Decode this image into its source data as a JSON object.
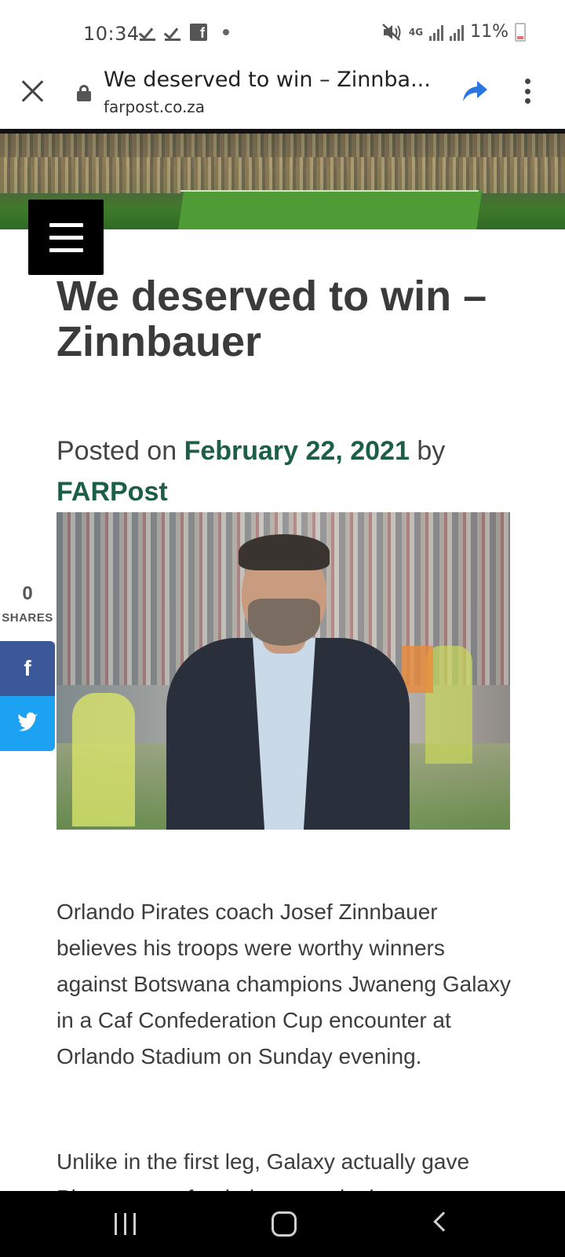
{
  "status_bar": {
    "time": "10:34",
    "network": "4G",
    "battery": "11%"
  },
  "browser": {
    "page_title": "We deserved to win – Zinnba...",
    "url": "farpost.co.za"
  },
  "article": {
    "title_line1": "We deserved to win –",
    "title_line2": "Zinnbauer",
    "posted_prefix": "Posted on",
    "date": "February 22, 2021",
    "by": "by",
    "author": "FARPost",
    "paragraph1": "Orlando Pirates coach Josef Zinnbauer believes his troops were worthy winners against Botswana champions Jwaneng Galaxy in a Caf Confederation Cup encounter at Orlando Stadium on Sunday evening.",
    "paragraph2": "Unlike in the first leg, Galaxy actually gave Pirates a run for their money in the return"
  },
  "share_sidebar": {
    "count": "0",
    "label": "SHARES"
  },
  "icons": {
    "facebook": "facebook-icon",
    "twitter": "twitter-icon",
    "menu": "hamburger-icon",
    "share": "share-arrow-icon"
  },
  "colors": {
    "link_green": "#1d5e46",
    "facebook_blue": "#3b5998",
    "twitter_blue": "#1da1f2",
    "share_arrow_blue": "#2b74e2"
  }
}
